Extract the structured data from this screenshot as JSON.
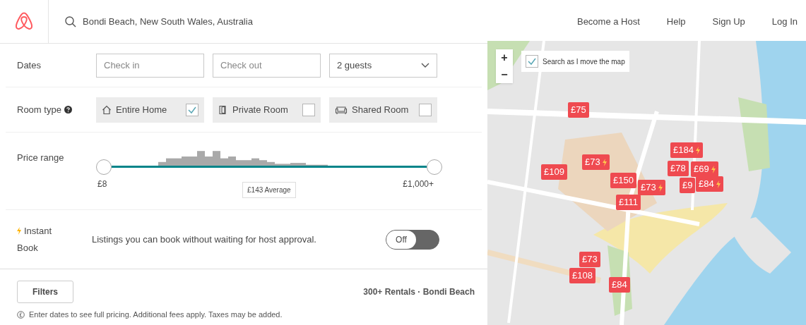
{
  "header": {
    "search_value": "Bondi Beach, New South Wales, Australia",
    "nav": [
      "Become a Host",
      "Help",
      "Sign Up",
      "Log In"
    ]
  },
  "dates": {
    "label": "Dates",
    "check_in": {
      "placeholder": "Check in"
    },
    "check_out": {
      "placeholder": "Check out"
    },
    "guests": "2 guests"
  },
  "room_type": {
    "label": "Room type",
    "options": [
      {
        "kind": "home",
        "label": "Entire Home",
        "checked": true
      },
      {
        "kind": "private",
        "label": "Private Room",
        "checked": false
      },
      {
        "kind": "shared",
        "label": "Shared Room",
        "checked": false
      }
    ]
  },
  "price_range": {
    "label": "Price range",
    "handles": [
      {
        "level": 0
      },
      {
        "level": 1
      }
    ],
    "min": "£8",
    "max": "£1,000+",
    "average": "£143 Average"
  },
  "instant_book": {
    "label_1": "Instant",
    "label_2": "Book",
    "description": "Listings you can book without waiting for host approval.",
    "toggle": {
      "on": false,
      "label": "Off"
    }
  },
  "footer": {
    "filters": "Filters",
    "count": "300+ Rentals · Bondi Beach",
    "note": "Enter dates to see full pricing. Additional fees apply. Taxes may be added."
  },
  "map": {
    "zoom_in": "+",
    "zoom_out": "−",
    "search_as_move": {
      "label": "Search as I move the map",
      "checked": true
    },
    "markers": [
      {
        "price": "£75",
        "instant": false
      },
      {
        "price": "£73",
        "instant": true
      },
      {
        "price": "£109",
        "instant": false
      },
      {
        "price": "£150",
        "instant": false
      },
      {
        "price": "£111",
        "instant": false
      },
      {
        "price": "£73",
        "instant": true
      },
      {
        "price": "£184",
        "instant": true
      },
      {
        "price": "£78",
        "instant": false
      },
      {
        "price": "£9",
        "instant": false
      },
      {
        "price": "£84",
        "instant": true
      },
      {
        "price": "£69",
        "instant": true
      },
      {
        "price": "£73",
        "instant": false
      },
      {
        "price": "£108",
        "instant": false
      },
      {
        "price": "£84",
        "instant": false
      }
    ]
  }
}
